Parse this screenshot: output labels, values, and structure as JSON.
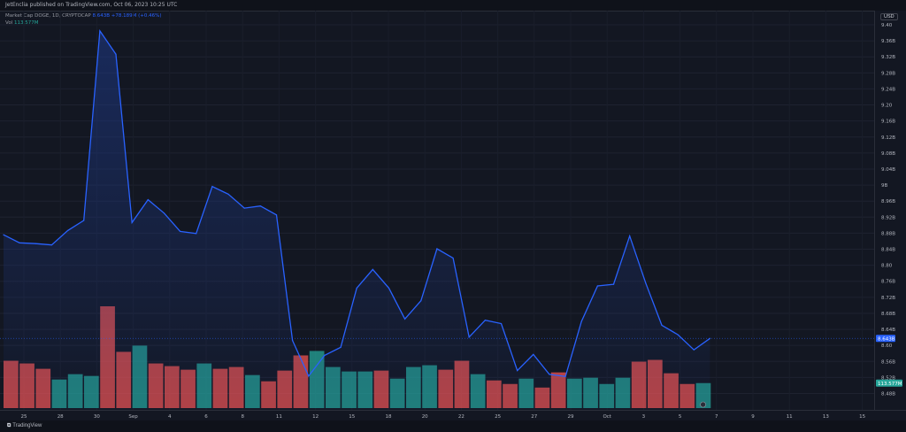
{
  "header": {
    "publisher": "JetEnclia published on TradingView.com, Oct 06, 2023 10:25 UTC",
    "symbol": "Market Cap DOGE, 1D, CRYPTOCAP",
    "last_value": "8.643B",
    "change": "+78.189M (+0.46%)",
    "vol_label": "Vol",
    "vol_value": "113.577M",
    "currency": "USD"
  },
  "footer": {
    "brand": "TradingView",
    "logo_icon": "tradingview-logo-icon"
  },
  "chart_data": {
    "type": "area",
    "x_tick_labels": [
      "25",
      "28",
      "30",
      "Sep",
      "4",
      "6",
      "8",
      "11",
      "12",
      "15",
      "18",
      "20",
      "22",
      "25",
      "27",
      "29",
      "Oct",
      "3",
      "5",
      "7",
      "9",
      "11",
      "13",
      "15"
    ],
    "y_tick_labels": [
      "9.40",
      "9.36B",
      "9.32B",
      "9.28B",
      "9.24B",
      "9.20",
      "9.16B",
      "9.12B",
      "9.08B",
      "9.04B",
      "9B",
      "8.96B",
      "8.92B",
      "8.88B",
      "8.84B",
      "8.80",
      "8.76B",
      "8.72B",
      "8.68B",
      "8.64B",
      "8.60",
      "8.56B",
      "8.52B",
      "8.48B"
    ],
    "ylim": [
      8.474,
      9.418
    ],
    "grid": true,
    "series": [
      {
        "values": [
          8.888,
          8.869,
          8.867,
          8.864,
          8.898,
          8.922,
          9.37,
          9.315,
          8.917,
          8.971,
          8.939,
          8.896,
          8.891,
          9.002,
          8.984,
          8.951,
          8.956,
          8.935,
          8.638,
          8.554,
          8.603,
          8.622,
          8.762,
          8.806,
          8.762,
          8.689,
          8.732,
          8.855,
          8.833,
          8.646,
          8.686,
          8.678,
          8.567,
          8.605,
          8.558,
          8.553,
          8.683,
          8.767,
          8.771,
          8.885,
          8.774,
          8.674,
          8.652,
          8.616,
          8.643
        ],
        "last_value": 8.643
      }
    ],
    "volume": {
      "label": "Vol",
      "values": [
        53,
        50,
        44,
        32,
        38,
        36,
        114,
        63,
        70,
        50,
        47,
        43,
        50,
        44,
        46,
        37,
        30,
        42,
        59,
        64,
        46,
        41,
        41,
        42,
        33,
        46,
        48,
        43,
        53,
        38,
        31,
        27,
        33,
        23,
        40,
        33,
        34,
        27,
        34,
        52,
        54,
        39,
        27,
        28
      ],
      "direction": [
        "down",
        "down",
        "down",
        "up",
        "up",
        "up",
        "down",
        "down",
        "up",
        "down",
        "down",
        "down",
        "up",
        "down",
        "down",
        "up",
        "down",
        "down",
        "down",
        "up",
        "up",
        "up",
        "up",
        "down",
        "up",
        "up",
        "up",
        "down",
        "down",
        "up",
        "down",
        "down",
        "up",
        "down",
        "down",
        "up",
        "up",
        "up",
        "up",
        "down",
        "down",
        "down",
        "down",
        "up"
      ],
      "last_value": "113.577M"
    },
    "colors": {
      "line": "#2962ff",
      "area_top": "#1e3a8a",
      "up_volume": "#26a69a",
      "down_volume": "#ef5350",
      "last_price_badge": "#2962ff",
      "last_volume_badge": "#26a69a"
    }
  }
}
